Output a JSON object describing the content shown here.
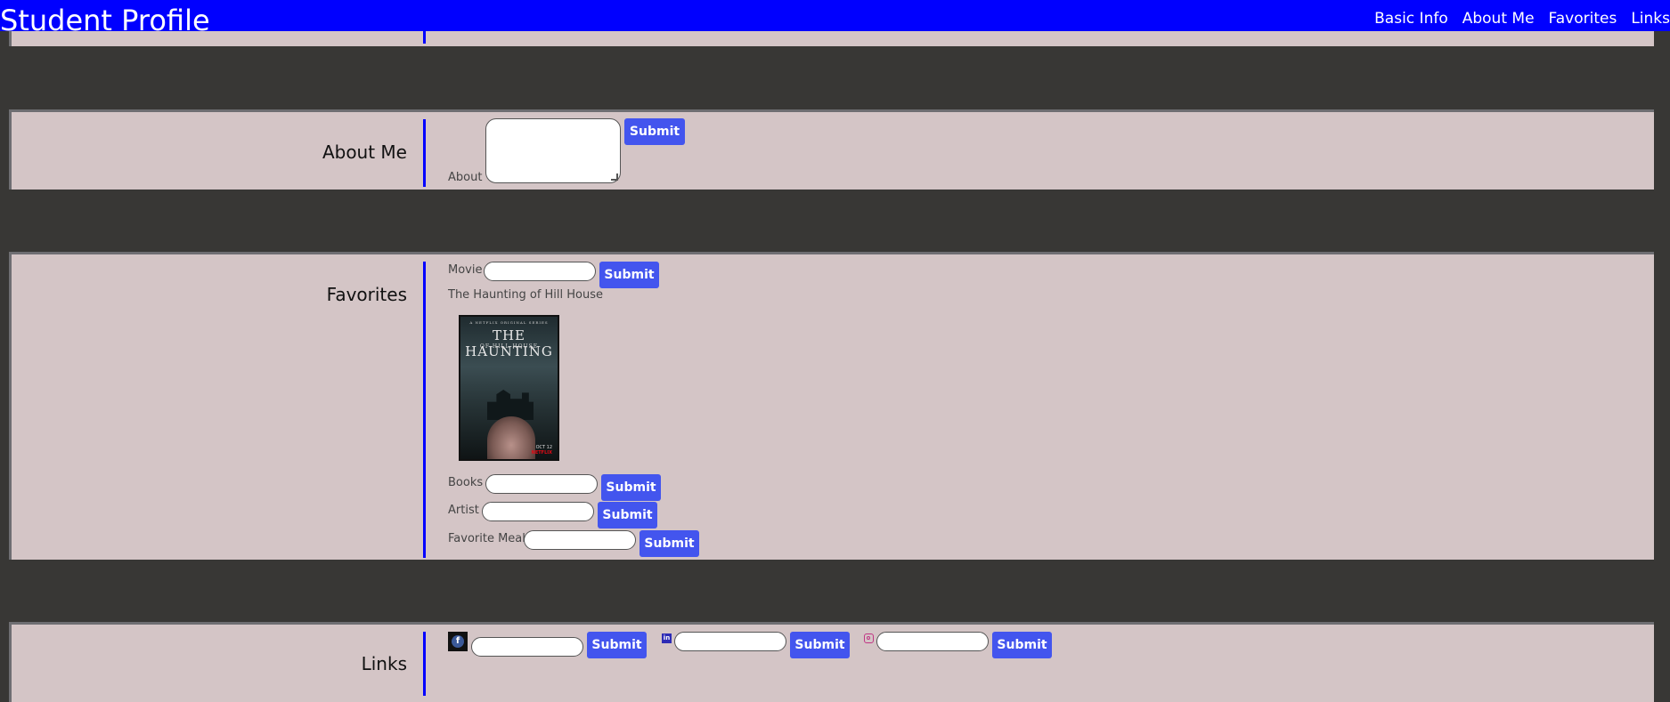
{
  "header": {
    "title": "Student Profile",
    "nav": [
      "Basic Info",
      "About Me",
      "Favorites",
      "Links"
    ]
  },
  "about": {
    "heading": "About Me",
    "label": "About",
    "value": "",
    "submit": "Submit"
  },
  "favorites": {
    "heading": "Favorites",
    "movie": {
      "label": "Movie",
      "value": "",
      "submit": "Submit"
    },
    "movie_result": "The Haunting of Hill House",
    "poster": {
      "top_text": "A NETFLIX ORIGINAL SERIES",
      "title": "THE HAUNTING",
      "subtitle": "OF HILL HOUSE",
      "date": "OCT 12",
      "brand": "NETFLIX"
    },
    "books": {
      "label": "Books",
      "value": "",
      "submit": "Submit"
    },
    "artist": {
      "label": "Artist",
      "value": "",
      "submit": "Submit"
    },
    "meal": {
      "label": "Favorite Meal",
      "value": "",
      "submit": "Submit"
    }
  },
  "links": {
    "heading": "Links",
    "facebook": {
      "icon": "facebook-icon",
      "value": "",
      "submit": "Submit"
    },
    "linkedin": {
      "icon": "linkedin-icon",
      "value": "",
      "submit": "Submit"
    },
    "instagram": {
      "icon": "instagram-icon",
      "value": "",
      "submit": "Submit"
    }
  },
  "colors": {
    "header_bg": "#0000ff",
    "page_bg": "#383735",
    "panel_bg": "#d4c5c6",
    "button_bg": "#4355ee",
    "divider": "#0000ff"
  }
}
